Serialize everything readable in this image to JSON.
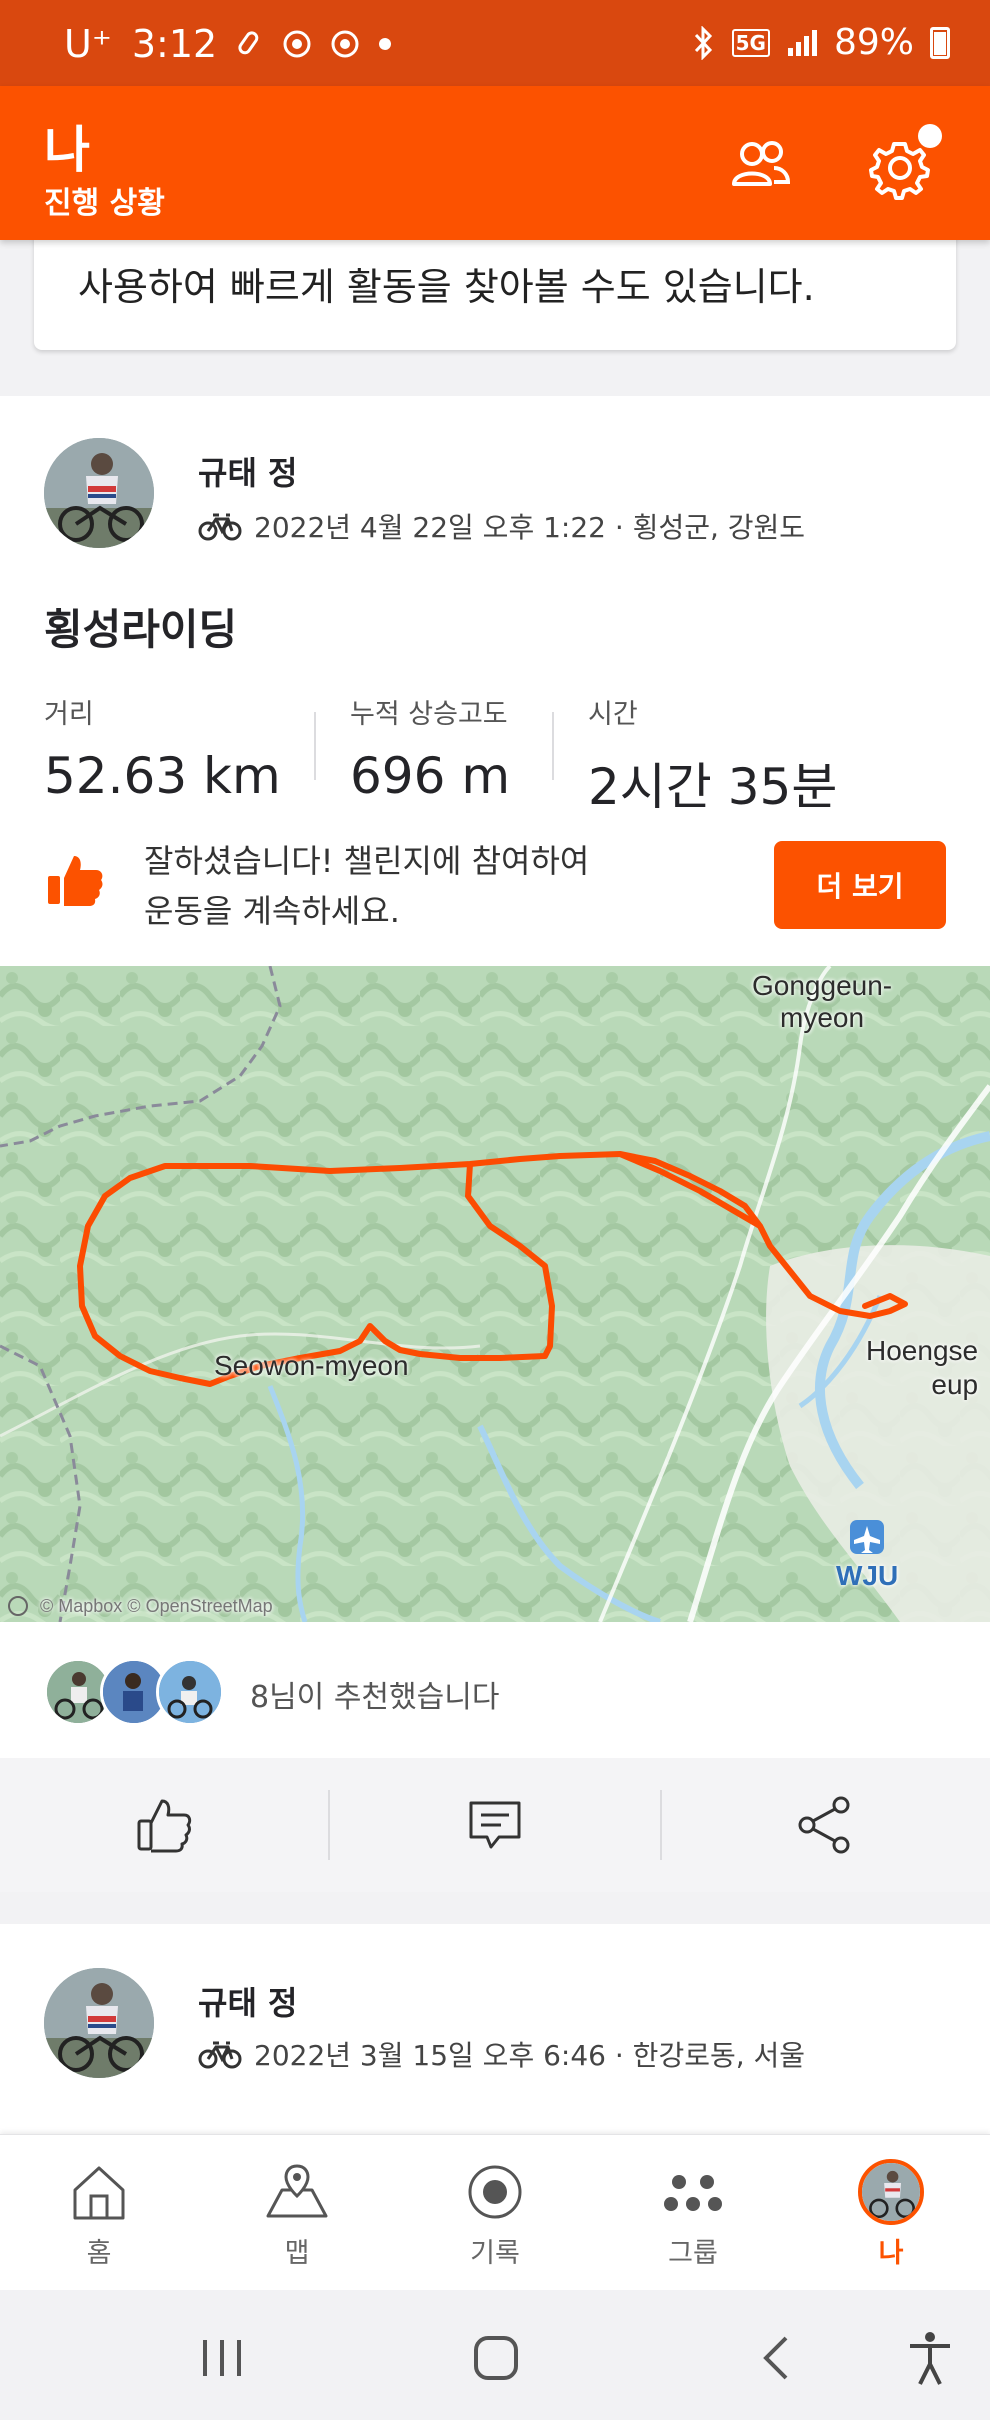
{
  "status_bar": {
    "carrier": "U⁺",
    "time": "3:12",
    "network": "5G",
    "battery": "89%",
    "icons": [
      "clip-icon",
      "chrome-icon",
      "chrome-icon",
      "bluetooth-icon",
      "signal-icon",
      "battery-icon"
    ]
  },
  "header": {
    "title": "나",
    "subtitle": "진행 상황",
    "friends_icon": "friends-icon",
    "settings_icon": "gear-icon",
    "notification_dot": true
  },
  "notice": {
    "text": "사용하여 빠르게 활동을 찾아볼 수도 있습니다."
  },
  "activity": {
    "athlete": "규태 정",
    "meta": "2022년 4월 22일 오후 1:22 · 횡성군, 강원도",
    "title": "횡성라이딩",
    "stats": [
      {
        "label": "거리",
        "value": "52.63 km"
      },
      {
        "label": "누적 상승고도",
        "value": "696 m"
      },
      {
        "label": "시간",
        "value": "2시간 35분"
      }
    ],
    "challenge_text_line1": "잘하셨습니다! 챌린지에 참여하여",
    "challenge_text_line2": "운동을 계속하세요.",
    "challenge_button": "더 보기",
    "map": {
      "labels": {
        "gonggeun_1": "Gonggeun-",
        "gonggeun_2": "myeon",
        "seowon": "Seowon-myeon",
        "hoengseong_1": "Hoengse",
        "hoengseong_2": "eup",
        "airport": "WJU"
      },
      "attribution": "© Mapbox © OpenStreetMap",
      "route_color": "#fc4c02"
    },
    "kudos_text": "8님이 추천했습니다",
    "actions": [
      "thumbs-up-icon",
      "comment-icon",
      "share-icon"
    ]
  },
  "activity2": {
    "athlete": "규태 정",
    "meta": "2022년 3월 15일 오후 6:46 · 한강로동, 서울"
  },
  "bottom_nav": [
    {
      "label": "홈",
      "icon": "home-icon",
      "active": false
    },
    {
      "label": "맵",
      "icon": "map-icon",
      "active": false
    },
    {
      "label": "기록",
      "icon": "record-icon",
      "active": false
    },
    {
      "label": "그룹",
      "icon": "groups-icon",
      "active": false
    },
    {
      "label": "나",
      "icon": "avatar",
      "active": true
    }
  ],
  "colors": {
    "brand": "#fc5200",
    "status_bar": "#d9480f"
  }
}
